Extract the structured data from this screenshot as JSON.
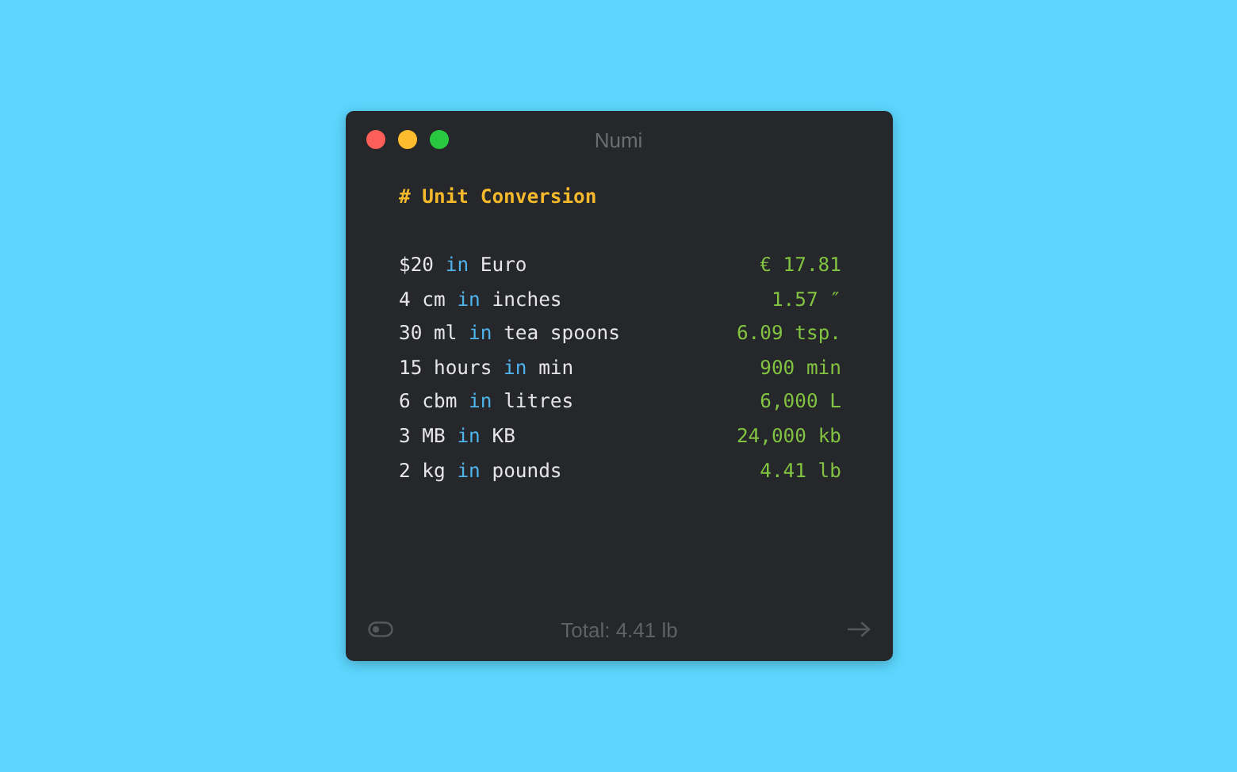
{
  "window": {
    "title": "Numi"
  },
  "heading": "# Unit Conversion",
  "lines": [
    {
      "amount": "$20",
      "keyword": "in",
      "target": "Euro",
      "result": "€ 17.81"
    },
    {
      "amount": "4 cm",
      "keyword": "in",
      "target": "inches",
      "result": "1.57 ″"
    },
    {
      "amount": "30 ml",
      "keyword": "in",
      "target": "tea spoons",
      "result": "6.09 tsp."
    },
    {
      "amount": "15 hours",
      "keyword": "in",
      "target": "min",
      "result": "900 min"
    },
    {
      "amount": "6 cbm",
      "keyword": "in",
      "target": "litres",
      "result": "6,000 L"
    },
    {
      "amount": "3 MB",
      "keyword": "in",
      "target": "KB",
      "result": "24,000 kb"
    },
    {
      "amount": "2 kg",
      "keyword": "in",
      "target": "pounds",
      "result": "4.41 lb"
    }
  ],
  "status_bar": {
    "total": "Total: 4.41 lb"
  }
}
